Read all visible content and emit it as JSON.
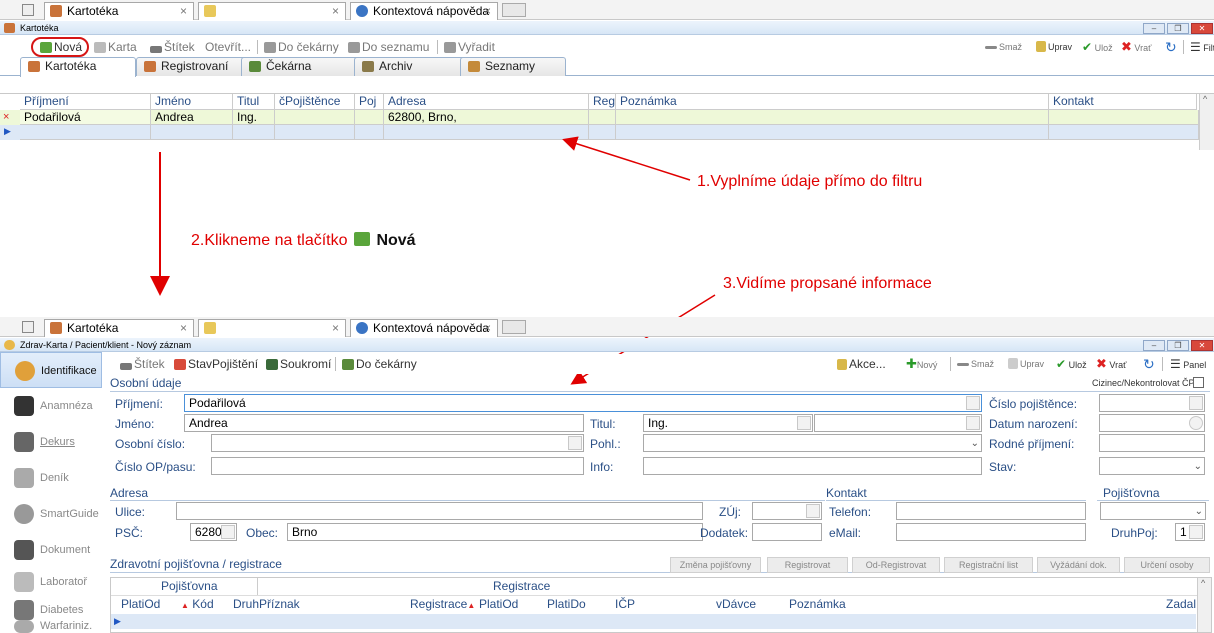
{
  "top": {
    "browser_tabs": [
      {
        "label": "Kartotéka"
      },
      {
        "label": ""
      },
      {
        "label": "Kontextová nápověda"
      }
    ],
    "window_title": "Kartotéka",
    "toolbar": {
      "nova": "Nová",
      "karta": "Karta",
      "stitek": "Štítek",
      "otevrit": "Otevřít...",
      "do_cekarny": "Do čekárny",
      "do_seznamu": "Do seznamu",
      "vyradit": "Vyřadit",
      "smaz": "Smaž",
      "uprav": "Uprav",
      "uloz": "Ulož",
      "vrat": "Vrať",
      "filtr": "Filtr"
    },
    "tabs": [
      "Kartotéka",
      "Registrovaní",
      "Čekárna",
      "Archiv",
      "Seznamy"
    ],
    "columns": [
      "Příjmení",
      "Jméno",
      "Titul",
      "čPojištěnce",
      "Poj",
      "Adresa",
      "Reg",
      "Poznámka",
      "Kontakt"
    ],
    "row": {
      "prijmeni": "Podařilová",
      "jmeno": "Andrea",
      "titul": "Ing.",
      "adresa": "62800, Brno,"
    }
  },
  "annotations": {
    "step1": "1.Vyplníme údaje přímo do filtru",
    "step2_prefix": "2.Klikneme na tlačítko",
    "step2_bold": "Nová",
    "step3": "3.Vidíme propsané informace"
  },
  "bottom": {
    "browser_tabs": [
      {
        "label": "Kartotéka"
      },
      {
        "label": ""
      },
      {
        "label": "Kontextová nápověda"
      }
    ],
    "window_title": "Zdrav-Karta / Pacient/klient - Nový záznam",
    "sidebar": [
      "Identifikace",
      "Anamnéza",
      "Dekurs",
      "Deník",
      "SmartGuide",
      "Dokument",
      "Laboratoř",
      "Diabetes",
      "Warfariniz."
    ],
    "toolbar": {
      "stitek": "Štítek",
      "stav": "StavPojištění",
      "soukromi": "Soukromí",
      "do_cekarny": "Do čekárny",
      "akce": "Akce...",
      "novy": "Nový",
      "smaz": "Smaž",
      "uprav": "Uprav",
      "uloz": "Ulož",
      "vrat": "Vrať",
      "panel": "Panel"
    },
    "form": {
      "osobni_udaje": "Osobní údaje",
      "cizinec": "Cizinec/Nekontrolovat ČP:",
      "prijmeni_lbl": "Příjmení:",
      "prijmeni_val": "Podařilová",
      "jmeno_lbl": "Jméno:",
      "jmeno_val": "Andrea",
      "osobni_cislo_lbl": "Osobní číslo:",
      "cislo_op_lbl": "Číslo OP/pasu:",
      "titul_lbl": "Titul:",
      "titul_val": "Ing.",
      "pohl_lbl": "Pohl.:",
      "info_lbl": "Info:",
      "cislo_poj_lbl": "Číslo pojištěnce:",
      "datum_lbl": "Datum narození:",
      "rodne_lbl": "Rodné příjmení:",
      "stav_lbl": "Stav:",
      "adresa": "Adresa",
      "ulice_lbl": "Ulice:",
      "psc_lbl": "PSČ:",
      "psc_val": "62800",
      "obec_lbl": "Obec:",
      "obec_val": "Brno",
      "zuj_lbl": "ZÚj:",
      "dodatek_lbl": "Dodatek:",
      "kontakt": "Kontakt",
      "telefon_lbl": "Telefon:",
      "email_lbl": "eMail:",
      "pojistovna": "Pojišťovna",
      "druhpoj_lbl": "DruhPoj:",
      "druhpoj_val": "1",
      "zp_section": "Zdravotní pojišťovna / registrace",
      "btn_zmena": "Změna pojišťovny",
      "btn_registrovat": "Registrovat",
      "btn_odreg": "Od-Registrovat",
      "btn_list": "Registrační list",
      "btn_vyzadani": "Vyžádání dok.",
      "btn_urceni": "Určení osoby",
      "grp_pojistovna": "Pojišťovna",
      "grp_registrace": "Registrace",
      "cols": [
        "PlatiOd",
        "Kód",
        "Druh",
        "Příznak",
        "Registrace",
        "PlatiOd",
        "PlatiDo",
        "IČP",
        "vDávce",
        "Poznámka",
        "Zadal"
      ]
    }
  }
}
